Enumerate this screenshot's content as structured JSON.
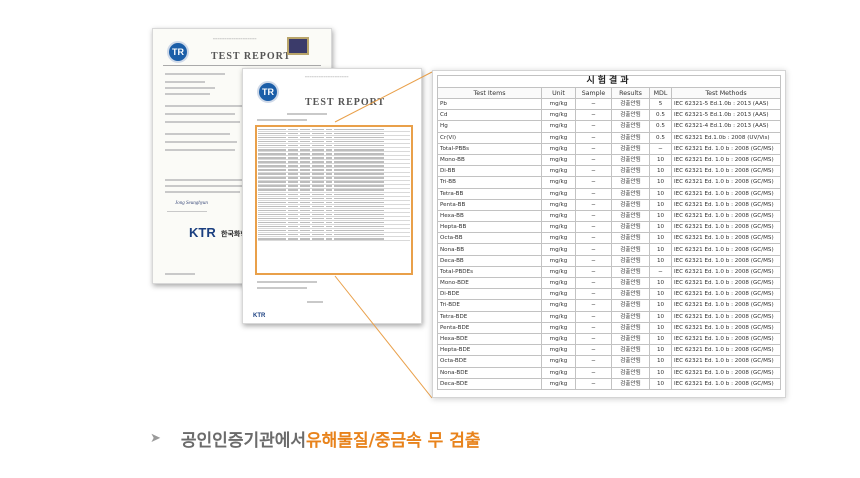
{
  "colors": {
    "accent_orange": "#e8831c",
    "highlight_frame": "#e9a04a",
    "caption_gray": "#6b6b6b",
    "logo_blue": "#1b5ea8",
    "logo_red": "#d2252a"
  },
  "back_document": {
    "logo": "TR",
    "title": "TEST REPORT",
    "issuer_logo_letters": "KTR",
    "issuer_name": "한국화학융"
  },
  "front_document": {
    "logo": "TR",
    "title": "TEST REPORT",
    "footer_logo": "KTR"
  },
  "result_table": {
    "title": "시험결과",
    "headers": [
      "Test Items",
      "Unit",
      "Sample",
      "Results",
      "MDL",
      "Test Methods"
    ],
    "rows": [
      {
        "item": "Pb",
        "unit": "mg/kg",
        "sample": "−",
        "result": "검출안됨",
        "mdl": "5",
        "method": "IEC 62321-5 Ed.1.0b : 2013 (AAS)"
      },
      {
        "item": "Cd",
        "unit": "mg/kg",
        "sample": "−",
        "result": "검출안됨",
        "mdl": "0.5",
        "method": "IEC 62321-5 Ed.1.0b : 2013 (AAS)"
      },
      {
        "item": "Hg",
        "unit": "mg/kg",
        "sample": "−",
        "result": "검출안됨",
        "mdl": "0.5",
        "method": "IEC 62321-4 Ed.1.0b : 2013 (AAS)"
      },
      {
        "item": "Cr(VI)",
        "unit": "mg/kg",
        "sample": "−",
        "result": "검출안됨",
        "mdl": "0.5",
        "method": "IEC 62321 Ed.1.0b : 2008 (UV/Vis)"
      },
      {
        "item": "Total-PBBs",
        "unit": "mg/kg",
        "sample": "−",
        "result": "검출안됨",
        "mdl": "−",
        "method": "IEC 62321 Ed. 1.0 b : 2008 (GC/MS)"
      },
      {
        "item": "Mono-BB",
        "unit": "mg/kg",
        "sample": "−",
        "result": "검출안됨",
        "mdl": "10",
        "method": "IEC 62321 Ed. 1.0 b : 2008 (GC/MS)"
      },
      {
        "item": "Di-BB",
        "unit": "mg/kg",
        "sample": "−",
        "result": "검출안됨",
        "mdl": "10",
        "method": "IEC 62321 Ed. 1.0 b : 2008 (GC/MS)"
      },
      {
        "item": "Tri-BB",
        "unit": "mg/kg",
        "sample": "−",
        "result": "검출안됨",
        "mdl": "10",
        "method": "IEC 62321 Ed. 1.0 b : 2008 (GC/MS)"
      },
      {
        "item": "Tetra-BB",
        "unit": "mg/kg",
        "sample": "−",
        "result": "검출안됨",
        "mdl": "10",
        "method": "IEC 62321 Ed. 1.0 b : 2008 (GC/MS)"
      },
      {
        "item": "Penta-BB",
        "unit": "mg/kg",
        "sample": "−",
        "result": "검출안됨",
        "mdl": "10",
        "method": "IEC 62321 Ed. 1.0 b : 2008 (GC/MS)"
      },
      {
        "item": "Hexa-BB",
        "unit": "mg/kg",
        "sample": "−",
        "result": "검출안됨",
        "mdl": "10",
        "method": "IEC 62321 Ed. 1.0 b : 2008 (GC/MS)"
      },
      {
        "item": "Hepta-BB",
        "unit": "mg/kg",
        "sample": "−",
        "result": "검출안됨",
        "mdl": "10",
        "method": "IEC 62321 Ed. 1.0 b : 2008 (GC/MS)"
      },
      {
        "item": "Octa-BB",
        "unit": "mg/kg",
        "sample": "−",
        "result": "검출안됨",
        "mdl": "10",
        "method": "IEC 62321 Ed. 1.0 b : 2008 (GC/MS)"
      },
      {
        "item": "Nona-BB",
        "unit": "mg/kg",
        "sample": "−",
        "result": "검출안됨",
        "mdl": "10",
        "method": "IEC 62321 Ed. 1.0 b : 2008 (GC/MS)"
      },
      {
        "item": "Deca-BB",
        "unit": "mg/kg",
        "sample": "−",
        "result": "검출안됨",
        "mdl": "10",
        "method": "IEC 62321 Ed. 1.0 b : 2008 (GC/MS)"
      },
      {
        "item": "Total-PBDEs",
        "unit": "mg/kg",
        "sample": "−",
        "result": "검출안됨",
        "mdl": "−",
        "method": "IEC 62321 Ed. 1.0 b : 2008 (GC/MS)"
      },
      {
        "item": "Mono-BDE",
        "unit": "mg/kg",
        "sample": "−",
        "result": "검출안됨",
        "mdl": "10",
        "method": "IEC 62321 Ed. 1.0 b : 2008 (GC/MS)"
      },
      {
        "item": "Di-BDE",
        "unit": "mg/kg",
        "sample": "−",
        "result": "검출안됨",
        "mdl": "10",
        "method": "IEC 62321 Ed. 1.0 b : 2008 (GC/MS)"
      },
      {
        "item": "Tri-BDE",
        "unit": "mg/kg",
        "sample": "−",
        "result": "검출안됨",
        "mdl": "10",
        "method": "IEC 62321 Ed. 1.0 b : 2008 (GC/MS)"
      },
      {
        "item": "Tetra-BDE",
        "unit": "mg/kg",
        "sample": "−",
        "result": "검출안됨",
        "mdl": "10",
        "method": "IEC 62321 Ed. 1.0 b : 2008 (GC/MS)"
      },
      {
        "item": "Penta-BDE",
        "unit": "mg/kg",
        "sample": "−",
        "result": "검출안됨",
        "mdl": "10",
        "method": "IEC 62321 Ed. 1.0 b : 2008 (GC/MS)"
      },
      {
        "item": "Hexa-BDE",
        "unit": "mg/kg",
        "sample": "−",
        "result": "검출안됨",
        "mdl": "10",
        "method": "IEC 62321 Ed. 1.0 b : 2008 (GC/MS)"
      },
      {
        "item": "Hepta-BDE",
        "unit": "mg/kg",
        "sample": "−",
        "result": "검출안됨",
        "mdl": "10",
        "method": "IEC 62321 Ed. 1.0 b : 2008 (GC/MS)"
      },
      {
        "item": "Octa-BDE",
        "unit": "mg/kg",
        "sample": "−",
        "result": "검출안됨",
        "mdl": "10",
        "method": "IEC 62321 Ed. 1.0 b : 2008 (GC/MS)"
      },
      {
        "item": "Nona-BDE",
        "unit": "mg/kg",
        "sample": "−",
        "result": "검출안됨",
        "mdl": "10",
        "method": "IEC 62321 Ed. 1.0 b : 2008 (GC/MS)"
      },
      {
        "item": "Deca-BDE",
        "unit": "mg/kg",
        "sample": "−",
        "result": "검출안됨",
        "mdl": "10",
        "method": "IEC 62321 Ed. 1.0 b : 2008 (GC/MS)"
      }
    ]
  },
  "caption": {
    "arrow_icon": "chevron-right-icon",
    "gray_text": "공인인증기관에서 ",
    "orange_text": "유해물질/중금속 무 검출"
  }
}
